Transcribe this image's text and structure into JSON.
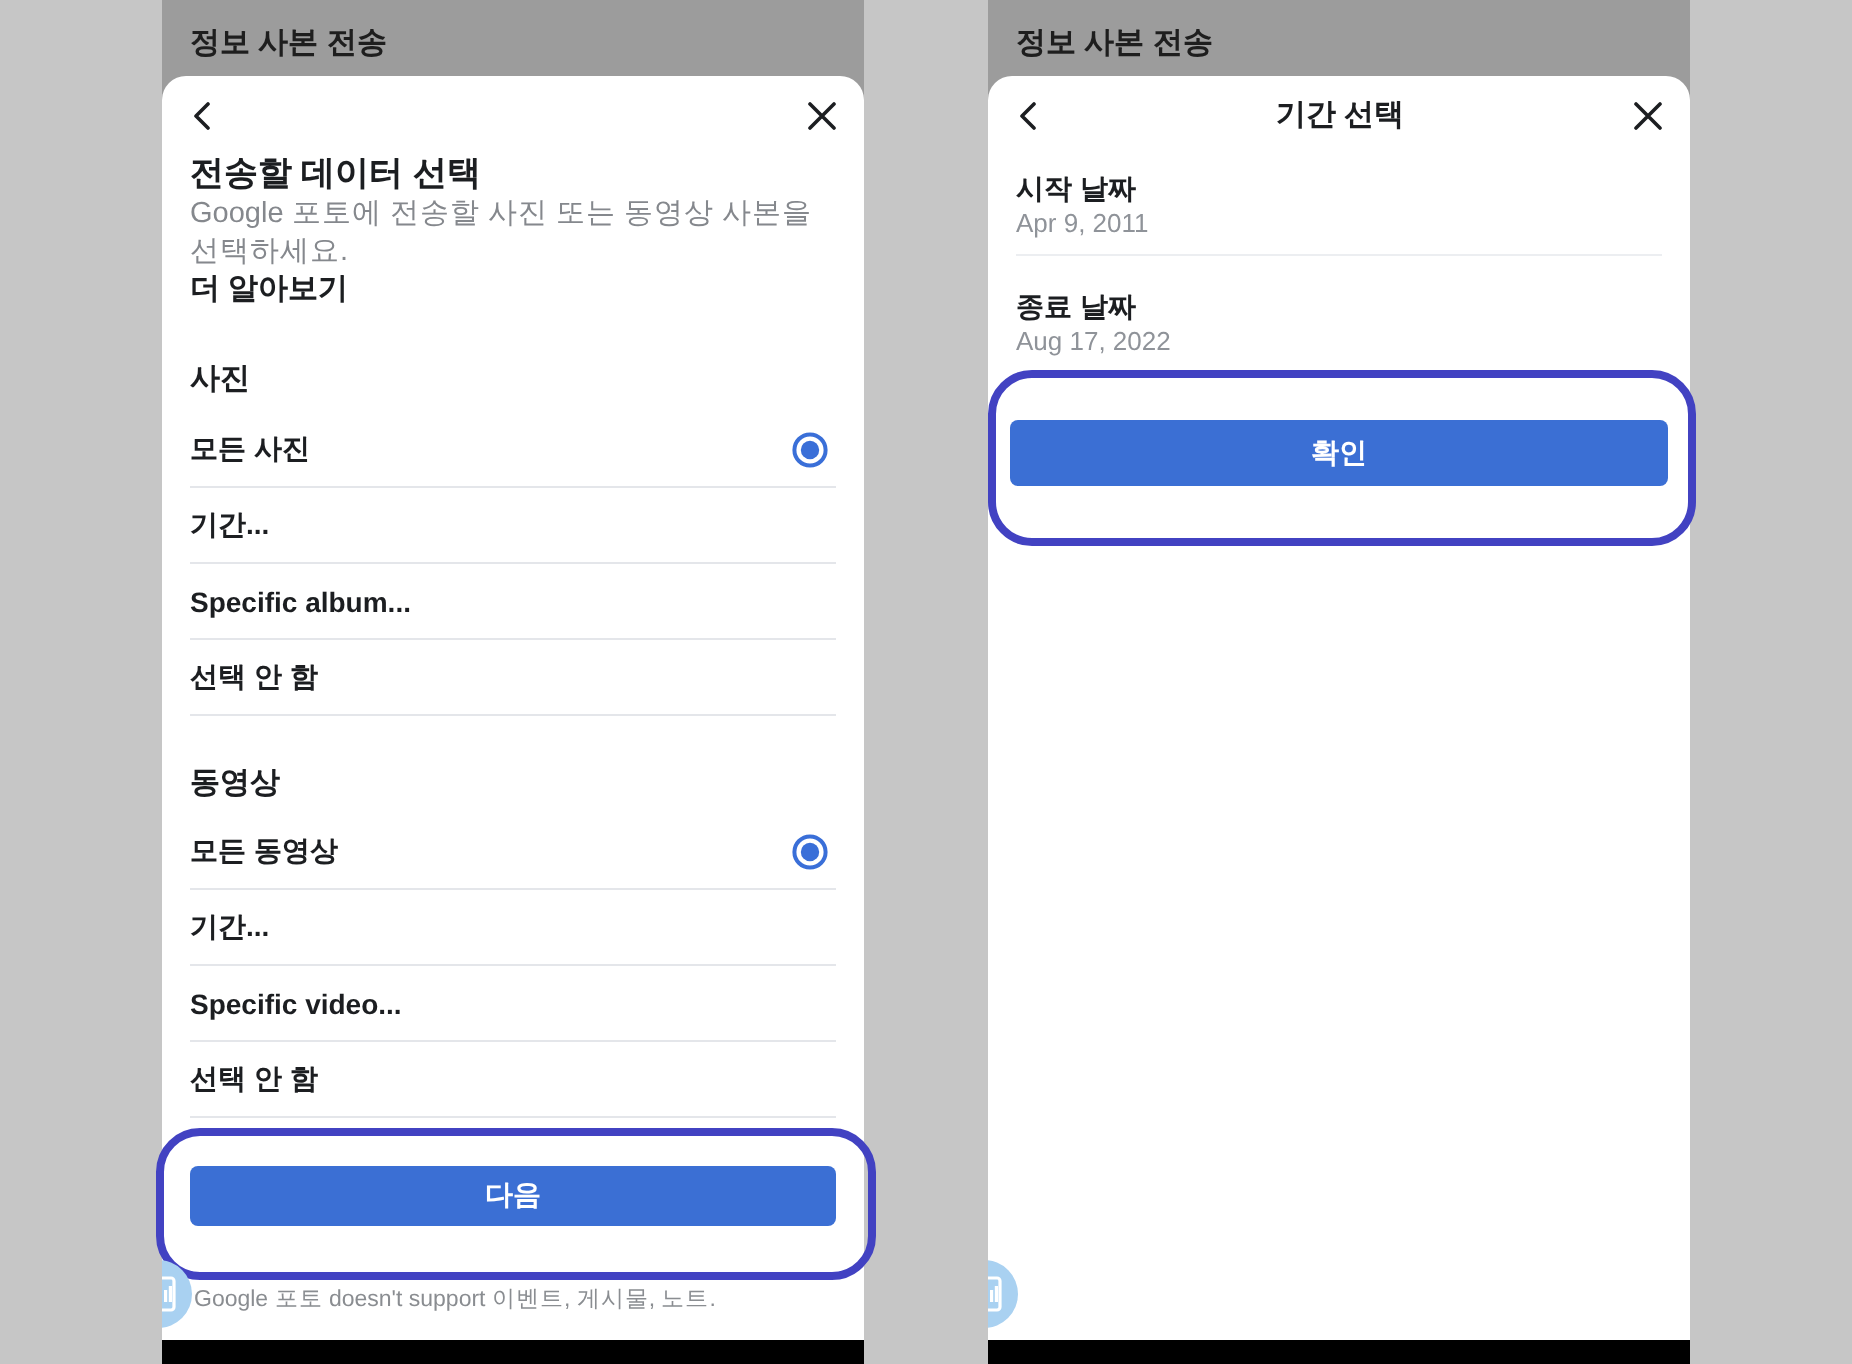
{
  "screens": [
    {
      "backdrop_title": "정보 사본 전송",
      "sheet": {
        "kind": "selection",
        "title": "전송할 데이터 선택",
        "description": "Google 포토에 전송할 사진 또는 동영상 사본을 선택하세요.",
        "link": "더 알아보기",
        "sections": [
          {
            "heading": "사진",
            "options": [
              {
                "label": "모든 사진",
                "selected": true
              },
              {
                "label": "기간...",
                "selected": false
              },
              {
                "label": "Specific album...",
                "selected": false
              },
              {
                "label": "선택 안 함",
                "selected": false
              }
            ]
          },
          {
            "heading": "동영상",
            "options": [
              {
                "label": "모든 동영상",
                "selected": true
              },
              {
                "label": "기간...",
                "selected": false
              },
              {
                "label": "Specific video...",
                "selected": false
              },
              {
                "label": "선택 안 함",
                "selected": false
              }
            ]
          }
        ],
        "button": {
          "label": "다음",
          "highlighted": true
        },
        "footer": "Google 포토 doesn't support 이벤트, 게시물, 노트."
      }
    },
    {
      "backdrop_title": "정보 사본 전송",
      "sheet": {
        "kind": "date_range",
        "title": "기간 선택",
        "fields": [
          {
            "label": "시작 날짜",
            "value": "Apr 9, 2011"
          },
          {
            "label": "종료 날짜",
            "value": "Aug 17, 2022"
          }
        ],
        "button": {
          "label": "확인",
          "highlighted": true
        }
      }
    }
  ]
}
